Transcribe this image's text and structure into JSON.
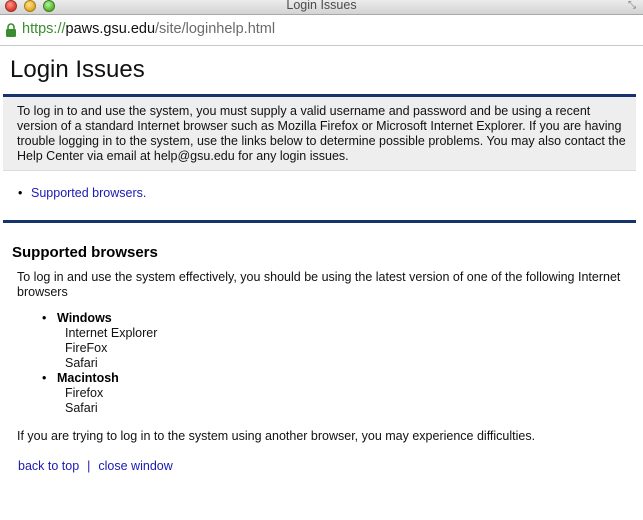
{
  "window": {
    "title": "Login Issues"
  },
  "address_bar": {
    "scheme": "https://",
    "host": "paws.gsu.edu",
    "path": "/site/loginhelp.html"
  },
  "page": {
    "title": "Login Issues",
    "intro": "To log in to and use the system, you must supply a valid username and password and be using a recent version of a standard Internet browser such as Mozilla Firefox or Microsoft Internet Explorer. If you are having trouble logging in to the system, use the links below to determine possible problems. You may also contact the Help Center via email at help@gsu.edu for any login issues.",
    "toc": [
      "Supported browsers."
    ]
  },
  "section": {
    "title": "Supported browsers",
    "lead": "To log in and use the system effectively, you should be using the latest version of one of the following Internet browsers",
    "platforms": [
      {
        "name": "Windows",
        "browsers": [
          "Internet Explorer",
          "FireFox",
          "Safari"
        ]
      },
      {
        "name": "Macintosh",
        "browsers": [
          "Firefox",
          "Safari"
        ]
      }
    ],
    "note": "If you are trying to log in to the system using another browser, you may experience difficulties."
  },
  "footer": {
    "back_to_top": "back to top",
    "separator": "|",
    "close_window": "close window"
  },
  "colors": {
    "rule": "#17336b",
    "link": "#1a1ab4",
    "intro_bg": "#eeeeee",
    "url_scheme": "#3a8d2e"
  },
  "icons": [
    "lock-icon",
    "resize-icon"
  ]
}
